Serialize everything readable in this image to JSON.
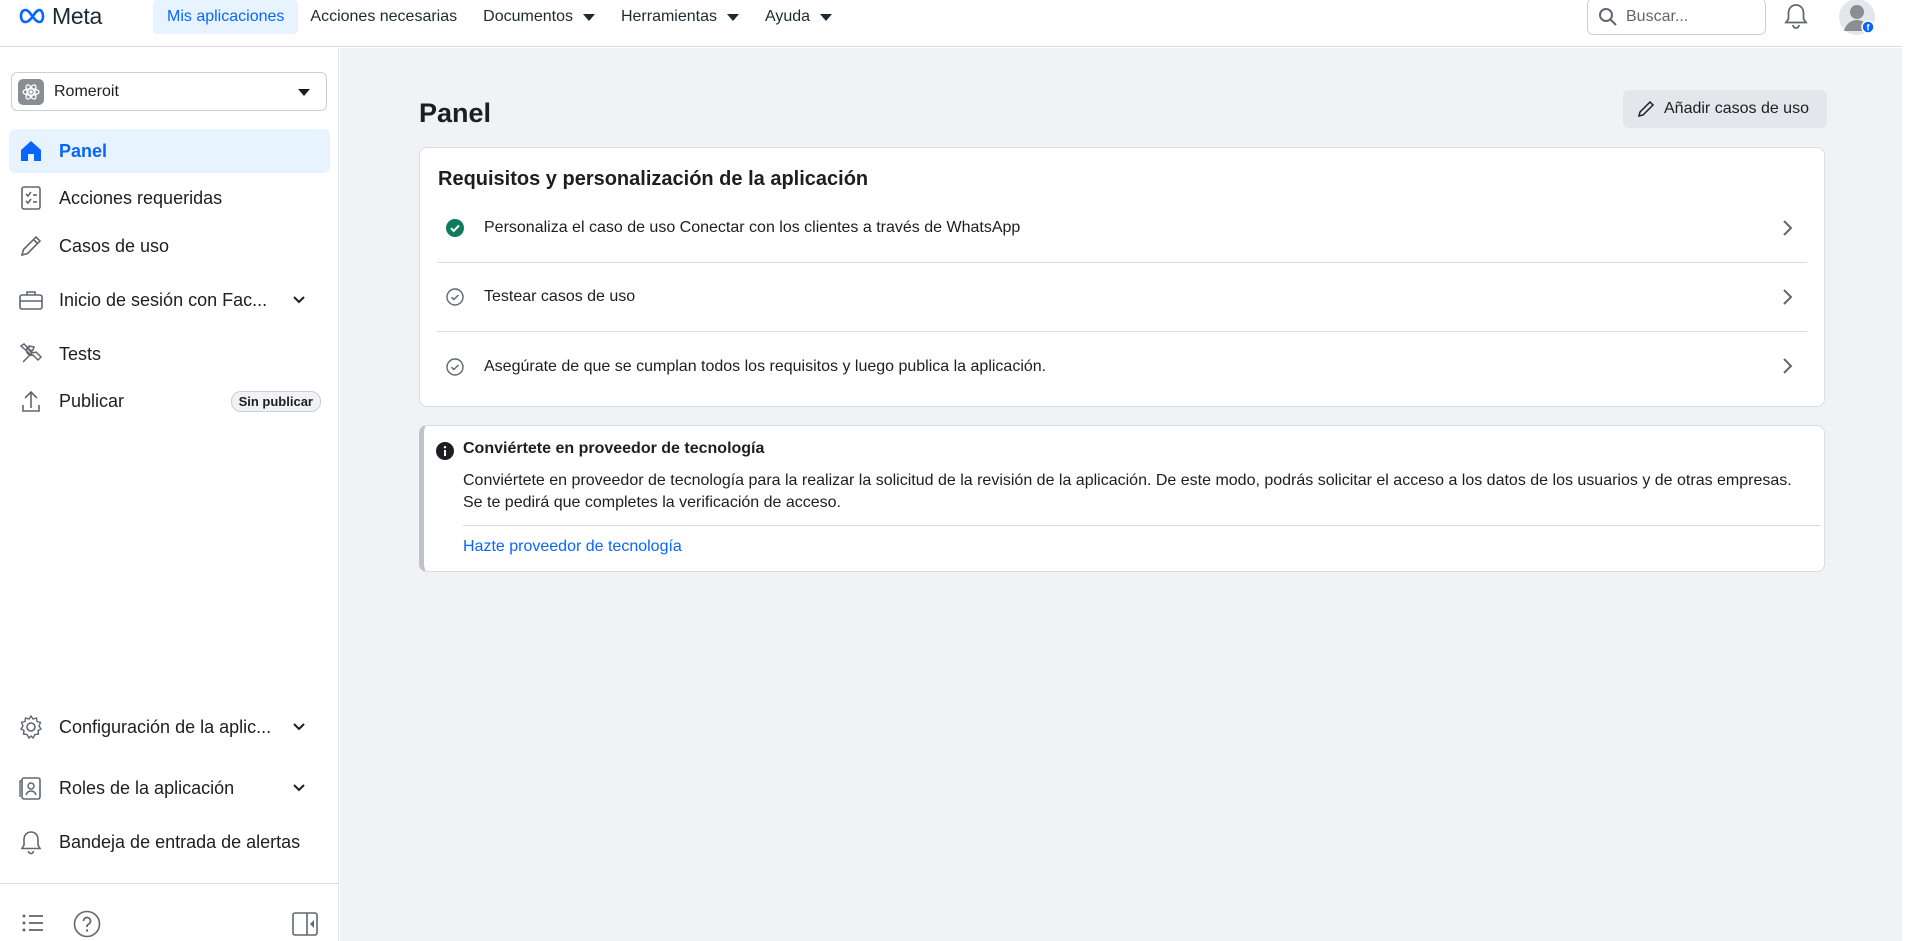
{
  "topbar": {
    "brand": "Meta",
    "nav": [
      {
        "label": "Mis aplicaciones",
        "active": true,
        "dropdown": false
      },
      {
        "label": "Acciones necesarias",
        "active": false,
        "dropdown": false
      },
      {
        "label": "Documentos",
        "active": false,
        "dropdown": true
      },
      {
        "label": "Herramientas",
        "active": false,
        "dropdown": true
      },
      {
        "label": "Ayuda",
        "active": false,
        "dropdown": true
      }
    ],
    "search_placeholder": "Buscar..."
  },
  "sidebar": {
    "app_name": "Romeroit",
    "items": [
      {
        "label": "Panel",
        "icon": "home-icon",
        "active": true
      },
      {
        "label": "Acciones requeridas",
        "icon": "checklist-icon"
      },
      {
        "label": "Casos de uso",
        "icon": "pencil-icon"
      },
      {
        "label": "Inicio de sesión con Fac...",
        "icon": "briefcase-icon",
        "expandable": true
      },
      {
        "label": "Tests",
        "icon": "tools-icon"
      },
      {
        "label": "Publicar",
        "icon": "upload-icon",
        "badge": "Sin publicar"
      },
      {
        "label": "Configuración de la aplic...",
        "icon": "gear-icon",
        "expandable": true
      },
      {
        "label": "Roles de la aplicación",
        "icon": "id-badge-icon",
        "expandable": true
      },
      {
        "label": "Bandeja de entrada de alertas",
        "icon": "bell-icon"
      }
    ]
  },
  "main": {
    "title": "Panel",
    "add_button": "Añadir casos de uso",
    "requirements": {
      "title": "Requisitos y personalización de la aplicación",
      "tasks": [
        {
          "label": "Personaliza el caso de uso Conectar con los clientes a través de WhatsApp",
          "done": true
        },
        {
          "label": "Testear casos de uso",
          "done": false
        },
        {
          "label": "Asegúrate de que se cumplan todos los requisitos y luego publica la aplicación.",
          "done": false
        }
      ]
    },
    "tech_provider": {
      "title": "Conviértete en proveedor de tecnología",
      "text": "Conviértete en proveedor de tecnología para la realizar la solicitud de la revisión de la aplicación. De este modo, podrás solicitar el acceso a los datos de los usuarios y de otras empresas. Se te pedirá que completes la verificación de acceso.",
      "link": "Hazte proveedor de tecnología"
    }
  },
  "colors": {
    "accent": "#0866ff",
    "success": "#0f7a5c",
    "background": "#f0f2f5"
  }
}
